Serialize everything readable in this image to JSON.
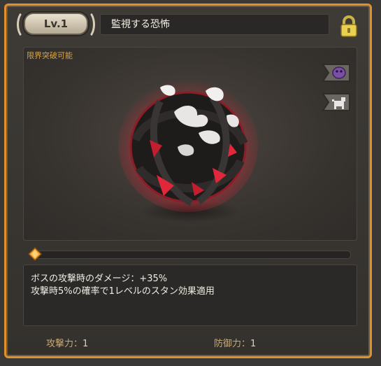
{
  "header": {
    "level_label": "Lv.1",
    "item_name": "監視する恐怖"
  },
  "image_area": {
    "limit_break_label": "限界突破可能"
  },
  "icons": {
    "lock": "padlock-icon",
    "side_top": "mask-icon",
    "side_bottom": "pet-icon",
    "progress_gem": "diamond-gem-icon"
  },
  "progress": {
    "fraction": 0.0
  },
  "description": {
    "line1": "ボスの攻撃時のダメージ：+35%",
    "line2": "攻撃時5%の確率で1レベルのスタン効果適用"
  },
  "stats": {
    "attack_label": "攻撃力：",
    "attack_value": "1",
    "defense_label": "防御力：",
    "defense_value": "1"
  },
  "colors": {
    "frame_accent": "#e0912c",
    "limit_label": "#d4a44e",
    "artifact_glow": "#e0283a"
  }
}
